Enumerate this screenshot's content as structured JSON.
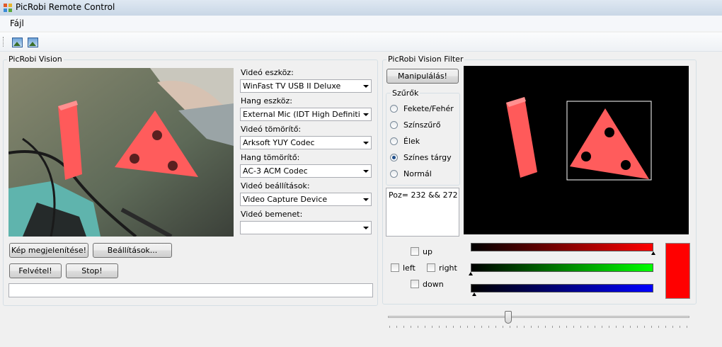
{
  "window": {
    "title": "PicRobi Remote Control"
  },
  "menu": {
    "file": "Fájl"
  },
  "toolbar": {
    "buttons": [
      {
        "icon": "picture-icon"
      },
      {
        "icon": "picture-icon"
      }
    ]
  },
  "vision": {
    "group_title": "PicRobi Vision",
    "video_device_label": "Videó eszköz:",
    "video_device": "WinFast TV USB II Deluxe",
    "audio_device_label": "Hang eszköz:",
    "audio_device": "External Mic (IDT High Definiti",
    "video_compressor_label": "Videó tömörítő:",
    "video_compressor": "Arksoft YUY Codec",
    "audio_compressor_label": "Hang tömörítő:",
    "audio_compressor": "AC-3 ACM Codec",
    "video_settings_label": "Videó beállítások:",
    "video_settings": "Video Capture Device",
    "video_input_label": "Videó bemenet:",
    "video_input": "",
    "show_image_button": "Kép megjelenítése!",
    "settings_button": "Beállítások...",
    "record_button": "Felvétel!",
    "stop_button": "Stop!",
    "status_text": ""
  },
  "filter": {
    "group_title": "PicRobi Vision Filter",
    "manipulate_button": "Manipulálás!",
    "filters_title": "Szűrők",
    "options": [
      {
        "label": "Fekete/Fehér",
        "checked": false
      },
      {
        "label": "Színszűrő",
        "checked": false
      },
      {
        "label": "Élek",
        "checked": false
      },
      {
        "label": "Színes tárgy",
        "checked": true
      },
      {
        "label": "Normál",
        "checked": false
      }
    ],
    "position_text": "Poz= 232 && 272",
    "directions": {
      "up": "up",
      "left": "left",
      "right": "right",
      "down": "down"
    },
    "red_level": 1.0,
    "green_level": 0.0,
    "blue_level": 0.02,
    "preview_color": "#ff0000",
    "slider_value": 0.4
  },
  "colors": {
    "accent": "#ff0000"
  }
}
